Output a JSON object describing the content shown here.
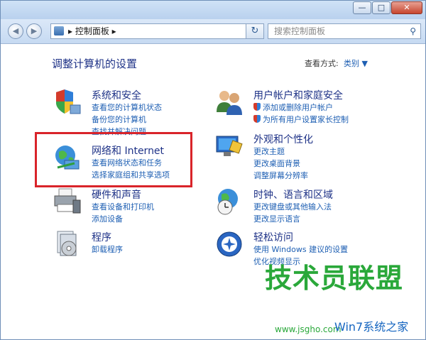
{
  "window": {
    "controls": {
      "minimize": "—",
      "maximize": "□",
      "close": "✕"
    }
  },
  "navbar": {
    "back_icon": "◀",
    "forward_icon": "▶",
    "address": "▸ 控制面板 ▸",
    "dropdown": "▼",
    "refresh": "↻",
    "search_placeholder": "搜索控制面板",
    "search_icon": "⚲"
  },
  "content": {
    "heading": "调整计算机的设置",
    "view_by_label": "查看方式:",
    "view_by_value": "类别 ▼",
    "categories": [
      {
        "icon": "security-shield-icon",
        "title": "系统和安全",
        "links": [
          "查看您的计算机状态",
          "备份您的计算机",
          "查找并解决问题"
        ]
      },
      {
        "icon": "network-globe-icon",
        "title": "网络和 Internet",
        "links": [
          "查看网络状态和任务",
          "选择家庭组和共享选项"
        ]
      },
      {
        "icon": "printer-icon",
        "title": "硬件和声音",
        "links": [
          "查看设备和打印机",
          "添加设备"
        ]
      },
      {
        "icon": "programs-icon",
        "title": "程序",
        "links": [
          "卸载程序"
        ]
      },
      {
        "icon": "users-icon",
        "title": "用户帐户和家庭安全",
        "links": [
          "添加或删除用户帐户",
          "为所有用户设置家长控制"
        ]
      },
      {
        "icon": "display-monitor-icon",
        "title": "外观和个性化",
        "links": [
          "更改主题",
          "更改桌面背景",
          "调整屏幕分辨率"
        ]
      },
      {
        "icon": "clock-globe-icon",
        "title": "时钟、语言和区域",
        "links": [
          "更改键盘或其他输入法",
          "更改显示语言"
        ]
      },
      {
        "icon": "ease-of-access-icon",
        "title": "轻松访问",
        "links": [
          "使用 Windows 建议的设置",
          "优化视频显示"
        ]
      }
    ]
  },
  "watermark": {
    "text": "技术员联盟",
    "url": "www.jsgho.com",
    "sub": "Win7系统之家"
  },
  "colors": {
    "highlight": "#d9242a",
    "title": "#1e3287",
    "link": "#1e5fb3",
    "watermark": "#2aa83a"
  }
}
